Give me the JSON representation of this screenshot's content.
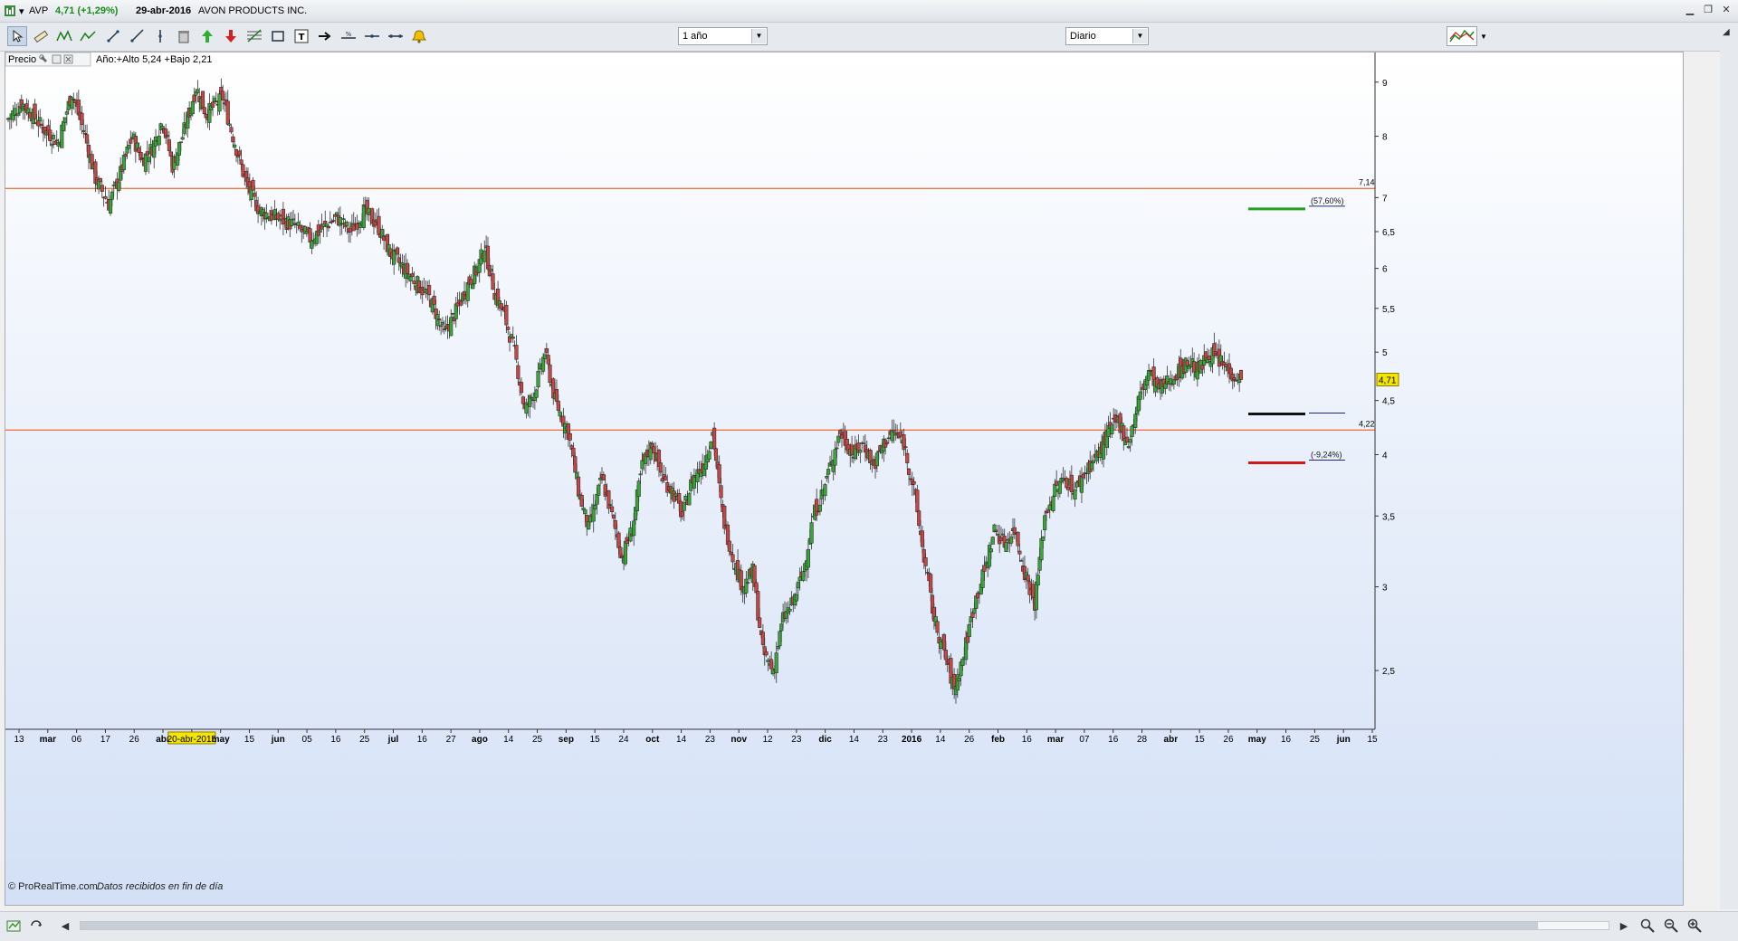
{
  "titlebar": {
    "symbol": "AVP",
    "price_change": "4,71 (+1,29%)",
    "date": "29-abr-2016",
    "company": "AVON PRODUCTS INC."
  },
  "toolbar": {
    "period": "1 año",
    "interval": "Diario",
    "icons": [
      "cursor-icon",
      "ruler-icon",
      "pattern-icon",
      "zigzag-icon",
      "line-icon",
      "ray-icon",
      "vertical-line-icon",
      "trash-icon",
      "buy-arrow-icon",
      "sell-arrow-icon",
      "fibonacci-icon",
      "rectangle-icon",
      "text-icon",
      "arrow-icon",
      "horizontal-line-icon",
      "extended-line-icon",
      "segment-icon",
      "alarm-icon"
    ]
  },
  "panel": {
    "name": "Precio",
    "info": "Año:+Alto 5,24 +Bajo 2,21"
  },
  "footer": {
    "copyright": "© ProRealTime.com",
    "note": "Datos recibidos en fin de día"
  },
  "colors": {
    "up": "#3ca33c",
    "down": "#c24848",
    "level_line": "#f07840",
    "target_up": "#22a022",
    "target_down": "#d01818",
    "price_tag": "#f5e600"
  },
  "chart_data": {
    "type": "candlestick",
    "y_scale": "log",
    "ylim": [
      2.2,
      9.6
    ],
    "y_ticks": [
      "9",
      "8",
      "7",
      "6,5",
      "6",
      "5,5",
      "5",
      "4,5",
      "4",
      "3,5",
      "3",
      "2,5"
    ],
    "y_tick_values": [
      9,
      8,
      7,
      6.5,
      6,
      5.5,
      5,
      4.5,
      4,
      3.5,
      3,
      2.5
    ],
    "x_labels": [
      "13",
      "mar",
      "06",
      "17",
      "26",
      "abr",
      "20-abr-2015",
      "may",
      "15",
      "jun",
      "05",
      "16",
      "25",
      "jul",
      "16",
      "27",
      "ago",
      "14",
      "25",
      "sep",
      "15",
      "24",
      "oct",
      "14",
      "23",
      "nov",
      "12",
      "23",
      "dic",
      "14",
      "23",
      "2016",
      "14",
      "26",
      "feb",
      "16",
      "mar",
      "07",
      "16",
      "28",
      "abr",
      "15",
      "26",
      "may",
      "16",
      "25",
      "jun",
      "15"
    ],
    "highlighted_x_label": "20-abr-2015",
    "last_price": "4,71",
    "last_close": 4.71,
    "levels": [
      {
        "value": 7.14,
        "label": "7,14"
      },
      {
        "value": 4.22,
        "label": "4,22"
      }
    ],
    "targets": [
      {
        "value": 6.83,
        "label": "(57,60%)",
        "kind": "up"
      },
      {
        "value": 4.37,
        "label": "",
        "kind": "current"
      },
      {
        "value": 3.93,
        "label": "(-9,24%)",
        "kind": "down"
      }
    ],
    "waypoints": [
      [
        0,
        8.3
      ],
      [
        8,
        8.6
      ],
      [
        14,
        8.4
      ],
      [
        22,
        8.1
      ],
      [
        30,
        7.9
      ],
      [
        38,
        8.8
      ],
      [
        46,
        8.0
      ],
      [
        52,
        7.3
      ],
      [
        60,
        6.9
      ],
      [
        66,
        7.3
      ],
      [
        74,
        8.0
      ],
      [
        80,
        7.6
      ],
      [
        86,
        7.8
      ],
      [
        92,
        8.3
      ],
      [
        98,
        7.5
      ],
      [
        104,
        8.0
      ],
      [
        112,
        8.9
      ],
      [
        118,
        8.4
      ],
      [
        128,
        8.7
      ],
      [
        134,
        8.0
      ],
      [
        142,
        7.2
      ],
      [
        150,
        6.8
      ],
      [
        160,
        6.7
      ],
      [
        170,
        6.6
      ],
      [
        180,
        6.4
      ],
      [
        190,
        6.6
      ],
      [
        196,
        6.7
      ],
      [
        204,
        6.5
      ],
      [
        212,
        6.8
      ],
      [
        220,
        6.6
      ],
      [
        228,
        6.2
      ],
      [
        236,
        6.0
      ],
      [
        244,
        5.8
      ],
      [
        252,
        5.6
      ],
      [
        260,
        5.2
      ],
      [
        268,
        5.5
      ],
      [
        274,
        5.8
      ],
      [
        280,
        6.0
      ],
      [
        284,
        6.3
      ],
      [
        290,
        5.7
      ],
      [
        296,
        5.4
      ],
      [
        302,
        5.0
      ],
      [
        308,
        4.4
      ],
      [
        314,
        4.6
      ],
      [
        320,
        5.0
      ],
      [
        326,
        4.5
      ],
      [
        334,
        4.2
      ],
      [
        340,
        3.7
      ],
      [
        346,
        3.4
      ],
      [
        354,
        3.8
      ],
      [
        360,
        3.5
      ],
      [
        366,
        3.2
      ],
      [
        372,
        3.4
      ],
      [
        378,
        3.9
      ],
      [
        384,
        4.1
      ],
      [
        390,
        3.8
      ],
      [
        396,
        3.7
      ],
      [
        402,
        3.5
      ],
      [
        408,
        3.8
      ],
      [
        414,
        3.9
      ],
      [
        420,
        4.2
      ],
      [
        426,
        3.5
      ],
      [
        432,
        3.2
      ],
      [
        438,
        3.0
      ],
      [
        444,
        3.1
      ],
      [
        450,
        2.6
      ],
      [
        456,
        2.5
      ],
      [
        462,
        2.8
      ],
      [
        468,
        2.9
      ],
      [
        474,
        3.1
      ],
      [
        480,
        3.5
      ],
      [
        486,
        3.7
      ],
      [
        492,
        4.0
      ],
      [
        496,
        4.2
      ],
      [
        504,
        4.0
      ],
      [
        510,
        4.1
      ],
      [
        516,
        3.9
      ],
      [
        522,
        4.1
      ],
      [
        528,
        4.2
      ],
      [
        534,
        4.1
      ],
      [
        540,
        3.7
      ],
      [
        546,
        3.2
      ],
      [
        552,
        2.8
      ],
      [
        558,
        2.6
      ],
      [
        564,
        2.4
      ],
      [
        570,
        2.6
      ],
      [
        576,
        2.9
      ],
      [
        582,
        3.1
      ],
      [
        588,
        3.4
      ],
      [
        594,
        3.3
      ],
      [
        600,
        3.4
      ],
      [
        606,
        3.1
      ],
      [
        612,
        2.9
      ],
      [
        618,
        3.5
      ],
      [
        624,
        3.7
      ],
      [
        630,
        3.8
      ],
      [
        636,
        3.7
      ],
      [
        644,
        3.9
      ],
      [
        650,
        4.0
      ],
      [
        656,
        4.2
      ],
      [
        662,
        4.3
      ],
      [
        668,
        4.1
      ],
      [
        674,
        4.5
      ],
      [
        680,
        4.8
      ],
      [
        686,
        4.6
      ],
      [
        692,
        4.7
      ],
      [
        698,
        4.8
      ],
      [
        704,
        4.9
      ],
      [
        710,
        4.8
      ],
      [
        716,
        5.0
      ],
      [
        722,
        4.9
      ],
      [
        728,
        4.8
      ],
      [
        735,
        4.71
      ]
    ]
  }
}
